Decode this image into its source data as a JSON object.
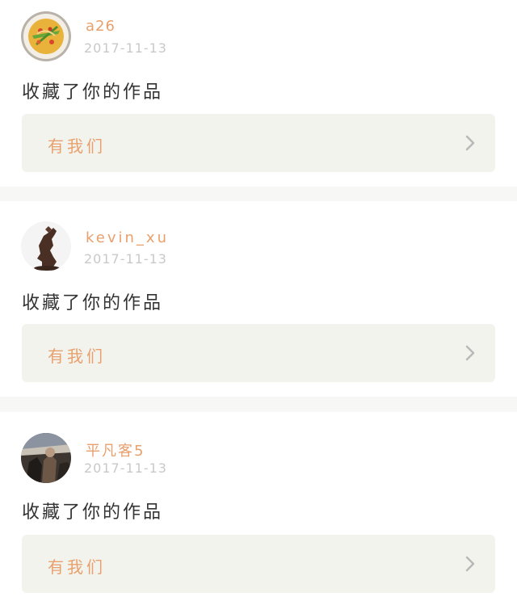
{
  "feed": {
    "items": [
      {
        "username": "a26",
        "date": "2017-11-13",
        "action": "收藏了你的作品",
        "work_title": "有我们",
        "avatar": "food-dish-avatar",
        "chevron": "chevron-right-icon"
      },
      {
        "username": "kevin_xu",
        "date": "2017-11-13",
        "action": "收藏了你的作品",
        "work_title": "有我们",
        "avatar": "horse-statue-avatar",
        "chevron": "chevron-right-icon"
      },
      {
        "username": "平凡客5",
        "date": "2017-11-13",
        "action": "收藏了你的作品",
        "work_title": "有我们",
        "avatar": "photo-avatar",
        "chevron": "chevron-right-icon"
      }
    ]
  },
  "colors": {
    "accent": "#e8a06d",
    "date": "#c9c9c9",
    "text": "#333333",
    "work_bg": "#f3f3ee",
    "separator": "#f7f7f5"
  }
}
